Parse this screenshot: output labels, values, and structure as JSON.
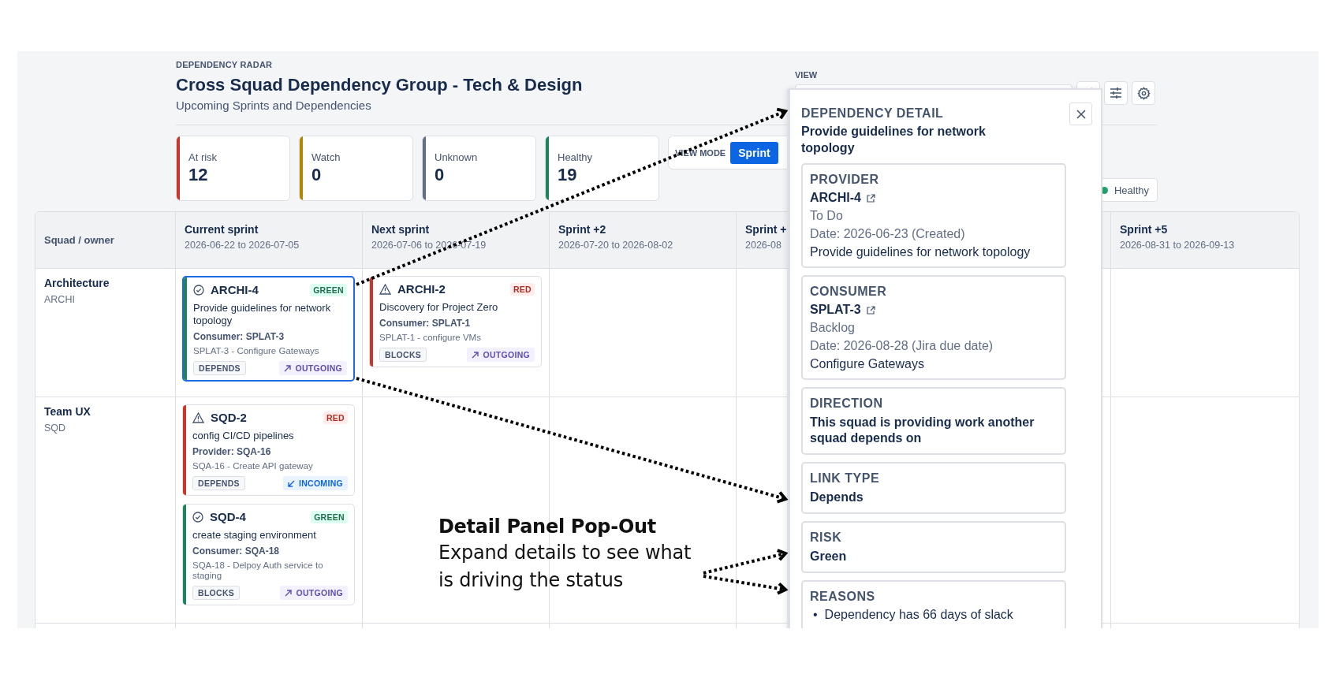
{
  "header": {
    "eyebrow": "DEPENDENCY RADAR",
    "title": "Cross Squad Dependency Group - Tech & Design",
    "subtitle": "Upcoming Sprints and Dependencies",
    "view_label": "VIEW"
  },
  "stats": [
    {
      "label": "At risk",
      "value": "12",
      "color": "#c9372c"
    },
    {
      "label": "Watch",
      "value": "0",
      "color": "#b38600"
    },
    {
      "label": "Unknown",
      "value": "0",
      "color": "#626f86"
    },
    {
      "label": "Healthy",
      "value": "19",
      "color": "#1f845a"
    }
  ],
  "view_mode": {
    "label": "VIEW MODE",
    "options": [
      {
        "label": "Sprint",
        "selected": true
      }
    ]
  },
  "legend": [
    {
      "label": "Healthy",
      "color": "#22a06b"
    }
  ],
  "table": {
    "row_header": "Squad / owner",
    "columns": [
      {
        "title": "Current sprint",
        "dates": "2026-06-22 to 2026-07-05"
      },
      {
        "title": "Next sprint",
        "dates": "2026-07-06 to 2026-07-19"
      },
      {
        "title": "Sprint +2",
        "dates": "2026-07-20 to 2026-08-02"
      },
      {
        "title": "Sprint +",
        "dates": "2026-08"
      },
      {
        "title": "Sprint +5",
        "dates": "2026-08-31 to 2026-09-13"
      }
    ],
    "rows": [
      {
        "squad": "Architecture",
        "key": "ARCHI",
        "cells": [
          [
            {
              "key": "ARCHI-4",
              "status": "GREEN",
              "summary": "Provide guidelines for network topology",
              "counterpart": "Consumer: SPLAT-3",
              "counterpart_summary": "SPLAT-3 - Configure Gateways",
              "link": "DEPENDS",
              "direction": "OUTGOING",
              "selected": true
            }
          ],
          [
            {
              "key": "ARCHI-2",
              "status": "RED",
              "summary": "Discovery for Project Zero",
              "counterpart": "Consumer: SPLAT-1",
              "counterpart_summary": "SPLAT-1 - configure VMs",
              "link": "BLOCKS",
              "direction": "OUTGOING",
              "selected": false
            }
          ],
          [],
          [],
          []
        ]
      },
      {
        "squad": "Team UX",
        "key": "SQD",
        "cells": [
          [
            {
              "key": "SQD-2",
              "status": "RED",
              "summary": "config CI/CD pipelines",
              "counterpart": "Provider: SQA-16",
              "counterpart_summary": "SQA-16 - Create API gateway",
              "link": "DEPENDS",
              "direction": "INCOMING",
              "selected": false
            },
            {
              "key": "SQD-4",
              "status": "GREEN",
              "summary": "create staging environment",
              "counterpart": "Consumer: SQA-18",
              "counterpart_summary": "SQA-18 - Delpoy Auth service to staging",
              "link": "BLOCKS",
              "direction": "OUTGOING",
              "selected": false
            }
          ],
          [],
          [],
          [],
          []
        ]
      }
    ]
  },
  "detail_panel": {
    "heading": "DEPENDENCY DETAIL",
    "title": "Provide guidelines for network topology",
    "sections": [
      {
        "kind": "issue",
        "label": "PROVIDER",
        "key": "ARCHI-4",
        "status": "To Do",
        "date": "Date: 2026-06-23 (Created)",
        "summary": "Provide guidelines for network topology"
      },
      {
        "kind": "issue",
        "label": "CONSUMER",
        "key": "SPLAT-3",
        "status": "Backlog",
        "date": "Date: 2026-08-28 (Jira due date)",
        "summary": "Configure Gateways"
      },
      {
        "kind": "text",
        "label": "DIRECTION",
        "value": "This squad is providing work another squad depends on"
      },
      {
        "kind": "text",
        "label": "LINK TYPE",
        "value": "Depends"
      },
      {
        "kind": "text",
        "label": "RISK",
        "value": "Green"
      },
      {
        "kind": "list",
        "label": "REASONS",
        "items": [
          {
            "bullet": "•",
            "text": "Dependency has 66 days of slack"
          }
        ]
      }
    ]
  },
  "annotation": {
    "title": "Detail Panel Pop-Out",
    "lines": [
      "Expand details to see what",
      "is driving the status"
    ]
  }
}
